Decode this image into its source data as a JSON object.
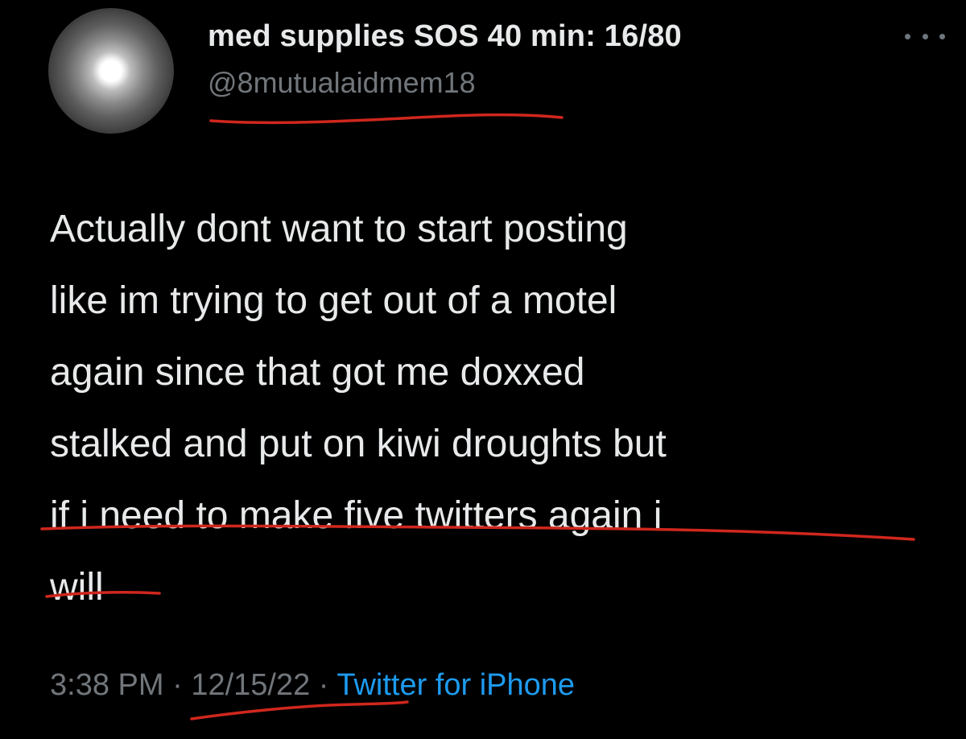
{
  "author": {
    "display_name": "med supplies SOS 40 min: 16/80",
    "handle": "@8mutualaidmem18"
  },
  "more_icon": "more-horizontal-icon",
  "tweet": {
    "lines": [
      "Actually dont want to start posting",
      "like im trying to get out of a motel",
      "again since that got me doxxed",
      "stalked and put on kiwi droughts but",
      "if i need to make five twitters again i",
      "will"
    ]
  },
  "meta": {
    "time": "3:38 PM",
    "separator": " · ",
    "date": "12/15/22",
    "source": "Twitter for iPhone"
  },
  "colors": {
    "background": "#000000",
    "text": "#e7e9ea",
    "secondary_text": "#71767b",
    "link": "#1d9bf0",
    "annotation_red": "#d0271d"
  }
}
